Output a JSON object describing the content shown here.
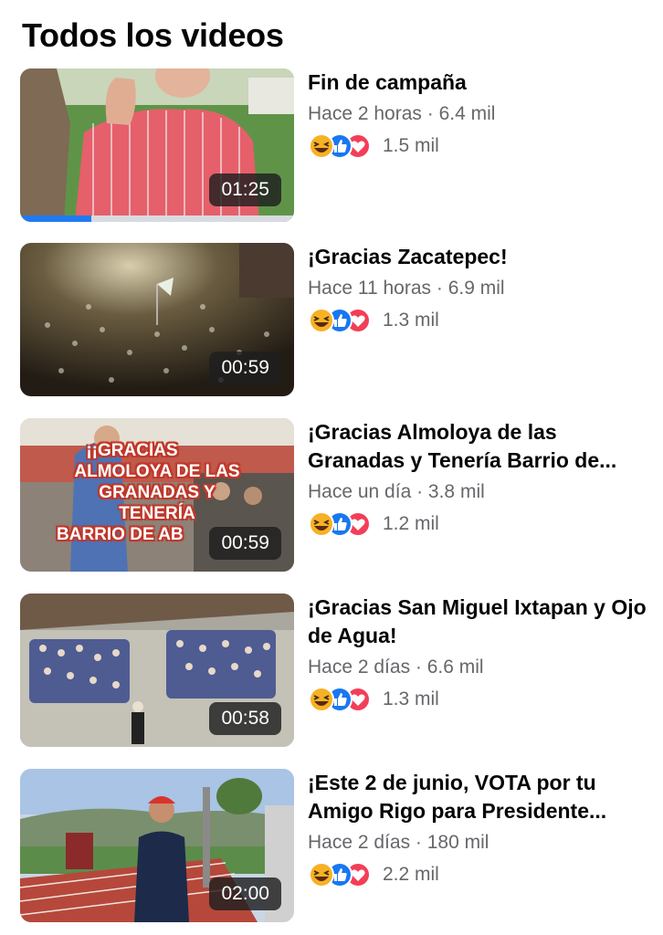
{
  "header": {
    "title": "Todos los videos"
  },
  "videos": [
    {
      "title": "Fin de campaña",
      "time_ago": "Hace 2 horas",
      "views": "6.4 mil",
      "reactions": "1.5 mil",
      "duration": "01:25",
      "watched_fraction": 0.26
    },
    {
      "title": "¡Gracias Zacatepec!",
      "time_ago": "Hace 11 horas",
      "views": "6.9 mil",
      "reactions": "1.3 mil",
      "duration": "00:59"
    },
    {
      "title": "¡Gracias Almoloya de las Granadas y Tenería Barrio de...",
      "time_ago": "Hace un día",
      "views": "3.8 mil",
      "reactions": "1.2 mil",
      "duration": "00:59",
      "overlay_text": [
        "¡¡GRACIAS",
        "ALMOLOYA DE LAS",
        "GRANADAS Y",
        "TENERÍA",
        "BARRIO DE AB"
      ]
    },
    {
      "title": "¡Gracias San Miguel Ixtapan y Ojo de Agua!",
      "time_ago": "Hace 2 días",
      "views": "6.6 mil",
      "reactions": "1.3 mil",
      "duration": "00:58"
    },
    {
      "title": "¡Este 2 de junio, VOTA por tu Amigo Rigo para Presidente...",
      "time_ago": "Hace 2 días",
      "views": "180 mil",
      "reactions": "2.2 mil",
      "duration": "02:00"
    }
  ],
  "meta_separator": " · ",
  "reaction_icons": [
    "haha-icon",
    "like-icon",
    "love-icon"
  ],
  "colors": {
    "like": "#1877f2",
    "love": "#f33e58",
    "haha": "#f7b125",
    "progress": "#1f7bf2",
    "secondary_text": "#65676b"
  }
}
